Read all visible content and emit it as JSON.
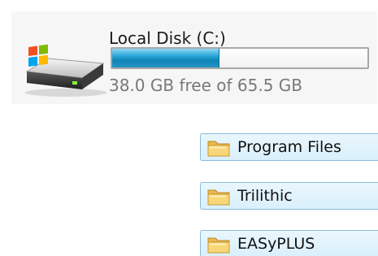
{
  "drive": {
    "name": "Local Disk (C:)",
    "free_text": "38.0 GB free of 65.5 GB",
    "used_fraction": 0.42,
    "icon": "windows-hard-drive-icon",
    "bar_color": "#1E9AD0"
  },
  "folders": [
    {
      "label": "Program Files",
      "icon": "folder-icon"
    },
    {
      "label": "Trilithic",
      "icon": "folder-icon"
    },
    {
      "label": "EASyPLUS",
      "icon": "folder-icon"
    }
  ]
}
